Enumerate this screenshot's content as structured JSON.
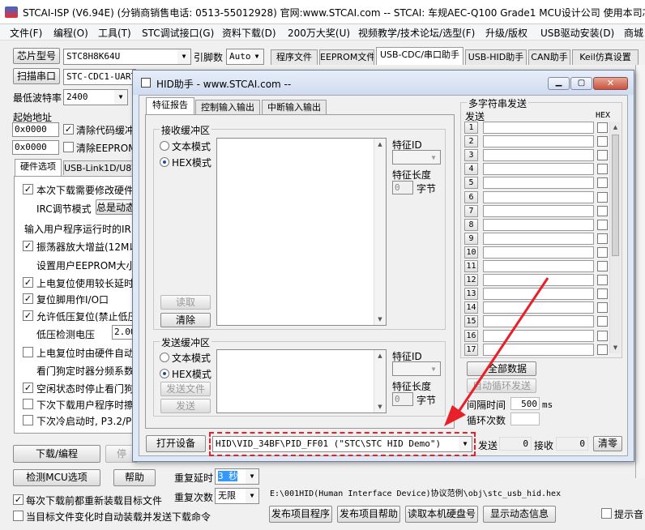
{
  "main": {
    "title": "STCAI-ISP (V6.94E) (分销商销售电话: 0513-55012928) 官网:www.STCAI.com  -- STCAI: 车规AEC-Q100 Grade1 MCU设计公司 使用本司芯片",
    "menu": [
      "文件(F)",
      "编程(O)",
      "工具(T)",
      "STC调试接口(G)",
      "资料下载(D)",
      "200万大奖(U)",
      "视频教学/技术论坛/选型(F)",
      "升级/版权",
      "USB驱动安装(D)",
      "商城"
    ],
    "chip_type_label": "芯片型号",
    "chip_type_value": "STC8H8K64U",
    "pin_label": "引脚数",
    "pin_value": "Auto",
    "scan_port_label": "扫描串口",
    "port_value": "STC-CDC1-UART1",
    "min_baud_label": "最低波特率",
    "min_baud_value": "2400",
    "start_addr_label": "起始地址",
    "addr1": "0x0000",
    "addr2": "0x0000",
    "clear_code_label": "清除代码缓冲",
    "clear_eeprom_label": "清除EEPROM缓",
    "left_tabs": [
      "硬件选项",
      "USB-Link1D/U8W"
    ],
    "hw_options": [
      {
        "label": "本次下载需要修改硬件",
        "checked": true
      },
      {
        "label": "IRC调节模式",
        "checked": null
      },
      {
        "label": "输入用户程序运行时的IR",
        "checked": null
      },
      {
        "label": "振荡器放大增益(12M以",
        "checked": true
      },
      {
        "label": "设置用户EEPROM大小",
        "checked": null
      },
      {
        "label": "上电复位使用较长延时",
        "checked": true
      },
      {
        "label": "复位脚用作I/O口",
        "checked": true
      },
      {
        "label": "允许低压复位(禁止低压",
        "checked": true
      },
      {
        "label": "低压检测电压",
        "checked": null
      },
      {
        "label": "上电复位时由硬件自动",
        "checked": false
      },
      {
        "label": "看门狗定时器分频系数",
        "checked": null
      },
      {
        "label": "空闲状态时停止看门狗",
        "checked": true
      },
      {
        "label": "下次下载用户程序时擦",
        "checked": false
      },
      {
        "label": "下次冷启动时, P3.2/P3",
        "checked": false
      }
    ],
    "irc_mode_button": "总是动态",
    "low_volt_value": "2.00",
    "right_tabs": [
      "程序文件",
      "EEPROM文件",
      "USB-CDC/串口助手",
      "USB-HID助手",
      "CAN助手",
      "Keil仿真设置"
    ],
    "download_button": "下载/编程",
    "stop_button_partial": "停",
    "check_mcu_button": "检测MCU选项",
    "help_button": "帮助",
    "repeat_delay_label": "重复延时",
    "repeat_delay_value": "3 秒",
    "repeat_count_label": "重复次数",
    "repeat_count_value": "无限",
    "reload_label": "每次下载前都重新装载目标文件",
    "auto_send_label": "当目标文件变化时自动装载并发送下载命令",
    "file_path": "E:\\001HID(Human Interface Device)协议范例\\obj\\stc_usb_hid.hex",
    "publish_program_button": "发布项目程序",
    "publish_help_button": "发布项目帮助",
    "read_disk_button": "读取本机硬盘号",
    "show_animation_button": "显示动态信息",
    "hint_sound_label": "提示音"
  },
  "hid": {
    "title": "HID助手 - www.STCAI.com --",
    "tabs": [
      "特征报告",
      "控制输入输出",
      "中断输入输出"
    ],
    "recv_group": "接收缓冲区",
    "text_mode": "文本模式",
    "hex_mode": "HEX模式",
    "read_button": "读取",
    "clear_button": "清除",
    "feature_id_label": "特征ID",
    "feature_len_label": "特征长度",
    "feature_len_value": "0",
    "bytes_label": "字节",
    "send_group": "发送缓冲区",
    "send_file_button": "发送文件",
    "send_button": "发送",
    "multi_title": "多字符串发送",
    "multi_send_header": "发送",
    "multi_hex_header": "HEX",
    "multi_rows": [
      "1",
      "2",
      "3",
      "4",
      "5",
      "6",
      "7",
      "8",
      "9",
      "10",
      "11",
      "12",
      "13",
      "14",
      "15",
      "16",
      "17"
    ],
    "send_all_button": "全部数据",
    "auto_loop_button": "自动循环发送",
    "interval_label": "间隔时间",
    "interval_value": "500",
    "interval_unit": "ms",
    "loop_count_label": "循环次数",
    "open_device_button": "打开设备",
    "device_value": "HID\\VID_34BF\\PID_FF01 (\"STC\\STC HID Demo\")",
    "send_count_label": "发送",
    "send_count_value": "0",
    "recv_count_label": "接收",
    "recv_count_value": "0",
    "clear_count_button": "清零"
  },
  "colors": {
    "annotation": "#e8202a",
    "selection": "#3399ff",
    "title_inactive": "#dfe8f5"
  }
}
